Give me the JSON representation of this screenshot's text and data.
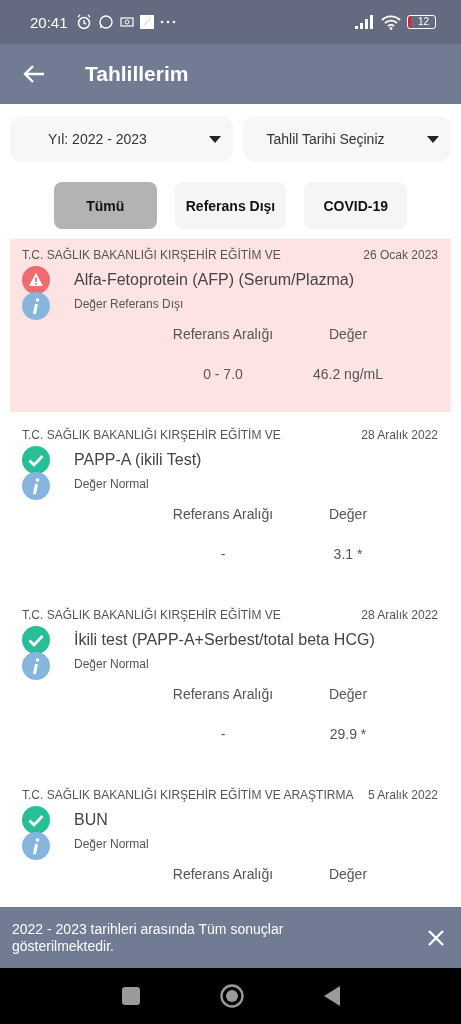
{
  "status_bar": {
    "time": "20:41",
    "battery": "12"
  },
  "header": {
    "title": "Tahlillerim"
  },
  "filters": [
    {
      "label": "Yıl: 2022 - 2023"
    },
    {
      "label": "Tahlil Tarihi Seçiniz"
    }
  ],
  "chips": [
    {
      "label": "Tümü",
      "selected": true
    },
    {
      "label": "Referans Dışı",
      "selected": false
    },
    {
      "label": "COVID-19",
      "selected": false
    }
  ],
  "results": [
    {
      "kind": "abnormal",
      "hospital": "T.C. SAĞLIK BAKANLIĞI KIRŞEHİR EĞİTİM VE",
      "date": "26 Ocak 2023",
      "test": "Alfa-Fetoprotein (AFP) (Serum/Plazma)",
      "status": "Değer Referans Dışı",
      "range_label": "Referans Aralığı",
      "value_label": "Değer",
      "range": "0 - 7.0",
      "value": "46.2 ng/mL"
    },
    {
      "kind": "normal",
      "hospital": "T.C. SAĞLIK BAKANLIĞI KIRŞEHİR EĞİTİM VE",
      "date": "28 Aralık 2022",
      "test": "PAPP-A (ikili Test)",
      "status": "Değer Normal",
      "range_label": "Referans Aralığı",
      "value_label": "Değer",
      "range": "-",
      "value": "3.1 *"
    },
    {
      "kind": "normal",
      "hospital": "T.C. SAĞLIK BAKANLIĞI KIRŞEHİR EĞİTİM VE",
      "date": "28 Aralık 2022",
      "test": "İkili test (PAPP-A+Serbest/total beta HCG)",
      "status": "Değer Normal",
      "range_label": "Referans Aralığı",
      "value_label": "Değer",
      "range": "-",
      "value": "29.9 *"
    },
    {
      "kind": "normal",
      "hospital": "T.C. SAĞLIK BAKANLIĞI KIRŞEHİR EĞİTİM VE ARAŞTIRMA",
      "date": "5 Aralık 2022",
      "test": "BUN",
      "status": "Değer Normal",
      "range_label": "Referans Aralığı",
      "value_label": "Değer"
    }
  ],
  "snackbar": {
    "message": "2022 - 2023 tarihleri arasında Tüm sonuçlar gösterilmektedir."
  }
}
